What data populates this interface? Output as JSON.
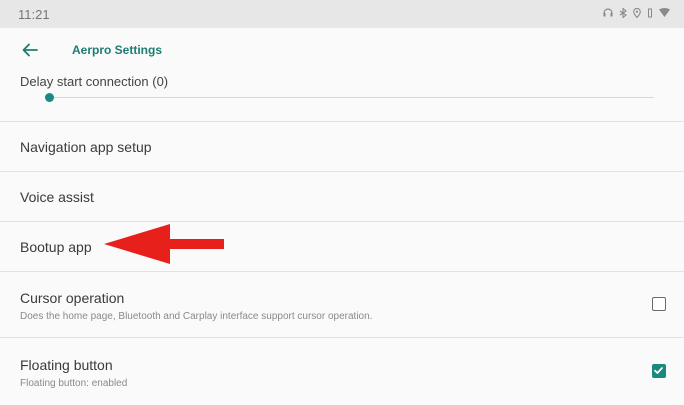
{
  "status_bar": {
    "time": "11:21",
    "icons": [
      "headphones-icon",
      "bluetooth-icon",
      "location-icon",
      "vibrate-icon",
      "wifi-icon"
    ]
  },
  "app_bar": {
    "title": "Aerpro Settings",
    "back_icon": "arrow-left-icon"
  },
  "slider": {
    "label": "Delay start connection (0)",
    "value": 0
  },
  "items": [
    {
      "title": "Navigation app setup"
    },
    {
      "title": "Voice assist"
    },
    {
      "title": "Bootup app"
    },
    {
      "title": "Cursor operation",
      "summary": "Does the home page, Bluetooth and Carplay interface support cursor operation.",
      "checked": false
    },
    {
      "title": "Floating button",
      "summary": "Floating button: enabled",
      "checked": true
    }
  ],
  "colors": {
    "accent": "#1b8a7e",
    "annotation_arrow": "#e8201c"
  }
}
